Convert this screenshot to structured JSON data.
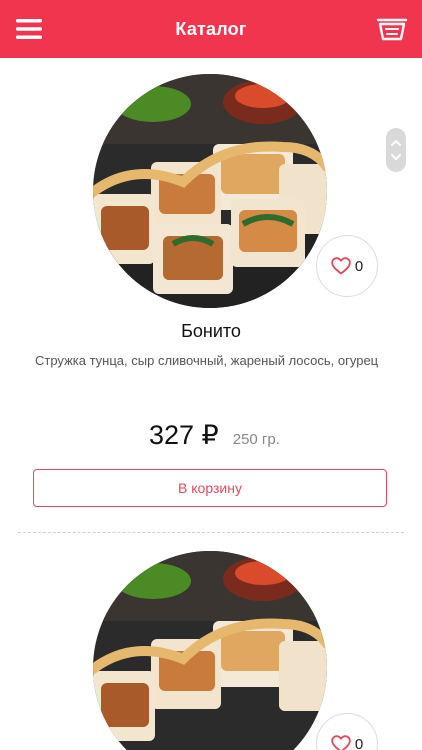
{
  "header": {
    "title": "Каталог",
    "menu_icon": "hamburger-menu-icon",
    "cart_icon": "basket-icon",
    "accent_color": "#f2354e"
  },
  "products": [
    {
      "name": "Бонито",
      "description": "Стружка тунца, сыр сливочный, жареный лосось, огурец",
      "price": "327 ₽",
      "weight": "250 гр.",
      "likes": "0",
      "add_to_cart_label": "В корзину"
    },
    {
      "likes": "0"
    }
  ]
}
